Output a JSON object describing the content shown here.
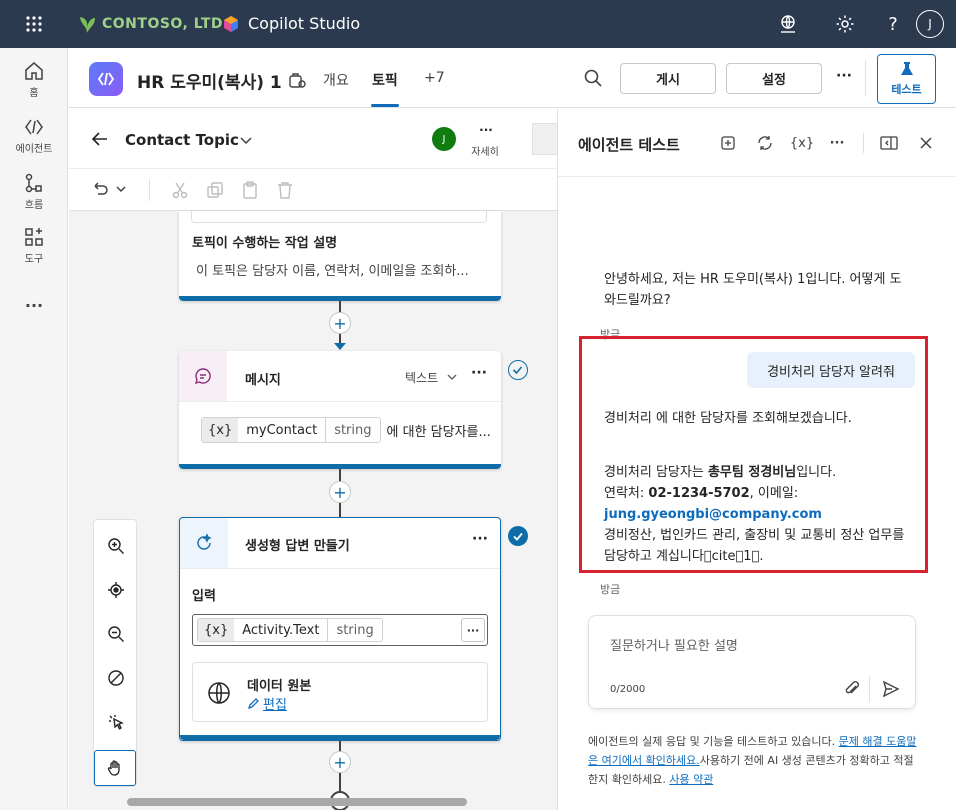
{
  "topbar": {
    "company": "CONTOSO, LTD.",
    "product": "Copilot Studio",
    "avatar": "J"
  },
  "rail": {
    "items": [
      {
        "label": "홈",
        "icon": "home-icon"
      },
      {
        "label": "에이전트",
        "icon": "agent-icon"
      },
      {
        "label": "흐름",
        "icon": "flow-icon"
      },
      {
        "label": "도구",
        "icon": "tools-icon"
      }
    ],
    "more": "..."
  },
  "header": {
    "agent_name": "HR 도우미(복사) 1",
    "tabs": [
      "개요",
      "토픽",
      "+7"
    ],
    "publish": "게시",
    "settings": "설정",
    "more": "···",
    "test": "테스트"
  },
  "canvas": {
    "topic_name": "Contact Topic",
    "owner_avatar": "J",
    "details_label": "자세히",
    "details_dots": "···",
    "trigger": {
      "title": "토픽이 수행하는 작업 설명",
      "desc": "이 토픽은 담당자 이름, 연락처, 이메일을 조회하..."
    },
    "message_node": {
      "title": "메시지",
      "mode": "텍스트",
      "more": "···",
      "var": "myContact",
      "type": "string",
      "suffix": "에 대한 담당자를..."
    },
    "gen_node": {
      "title": "생성형 답변 만들기",
      "more": "···",
      "input_label": "입력",
      "var": "Activity.Text",
      "type": "string",
      "source_title": "데이터 원본",
      "edit": "편집"
    },
    "var_icon": "{x}",
    "plus": "+"
  },
  "test_panel": {
    "title": "에이전트 테스트",
    "var_icon": "{x}",
    "more": "···",
    "greeting": "안녕하세요, 저는 HR 도우미(복사) 1입니다. 어떻게 도와드릴까요?",
    "time1": "방금",
    "user_msg": "경비처리 담당자 알려줘",
    "bot1": "경비처리 에 대한 담당자를 조회해보겠습니다.",
    "bot2_line1_a": "경비처리 담당자는 ",
    "bot2_line1_b": "총무팀 정경비님",
    "bot2_line1_c": "입니다.",
    "bot2_line2_a": "연락처: ",
    "bot2_line2_b": "02-1234-5702",
    "bot2_line2_c": ", 이메일:",
    "bot2_email": "jung.gyeongbi@company.com",
    "bot2_line3": "경비정산, 법인카드 관리, 출장비 및 교통비 정산 업무를 담당하고 계십니다\u0000cite\u00001\u0000.",
    "time2": "방금",
    "input_placeholder": "질문하거나 필요한 설명",
    "char_count": "0/2000",
    "footer_a": "에이전트의 실제 응답 및 기능을 테스트하고 있습니다. ",
    "footer_link1": "문제 해결 도움말은 여기에서 확인하세요.",
    "footer_b": "사용하기 전에 AI 생성 콘텐츠가 정확하고 적절한지 확인하세요. ",
    "footer_link2": "사용 약관"
  },
  "colors": {
    "topbar": "#2b3a4e",
    "accent": "#0f6cbd",
    "node_bar": "#0e6da8",
    "highlight": "#d72330"
  }
}
